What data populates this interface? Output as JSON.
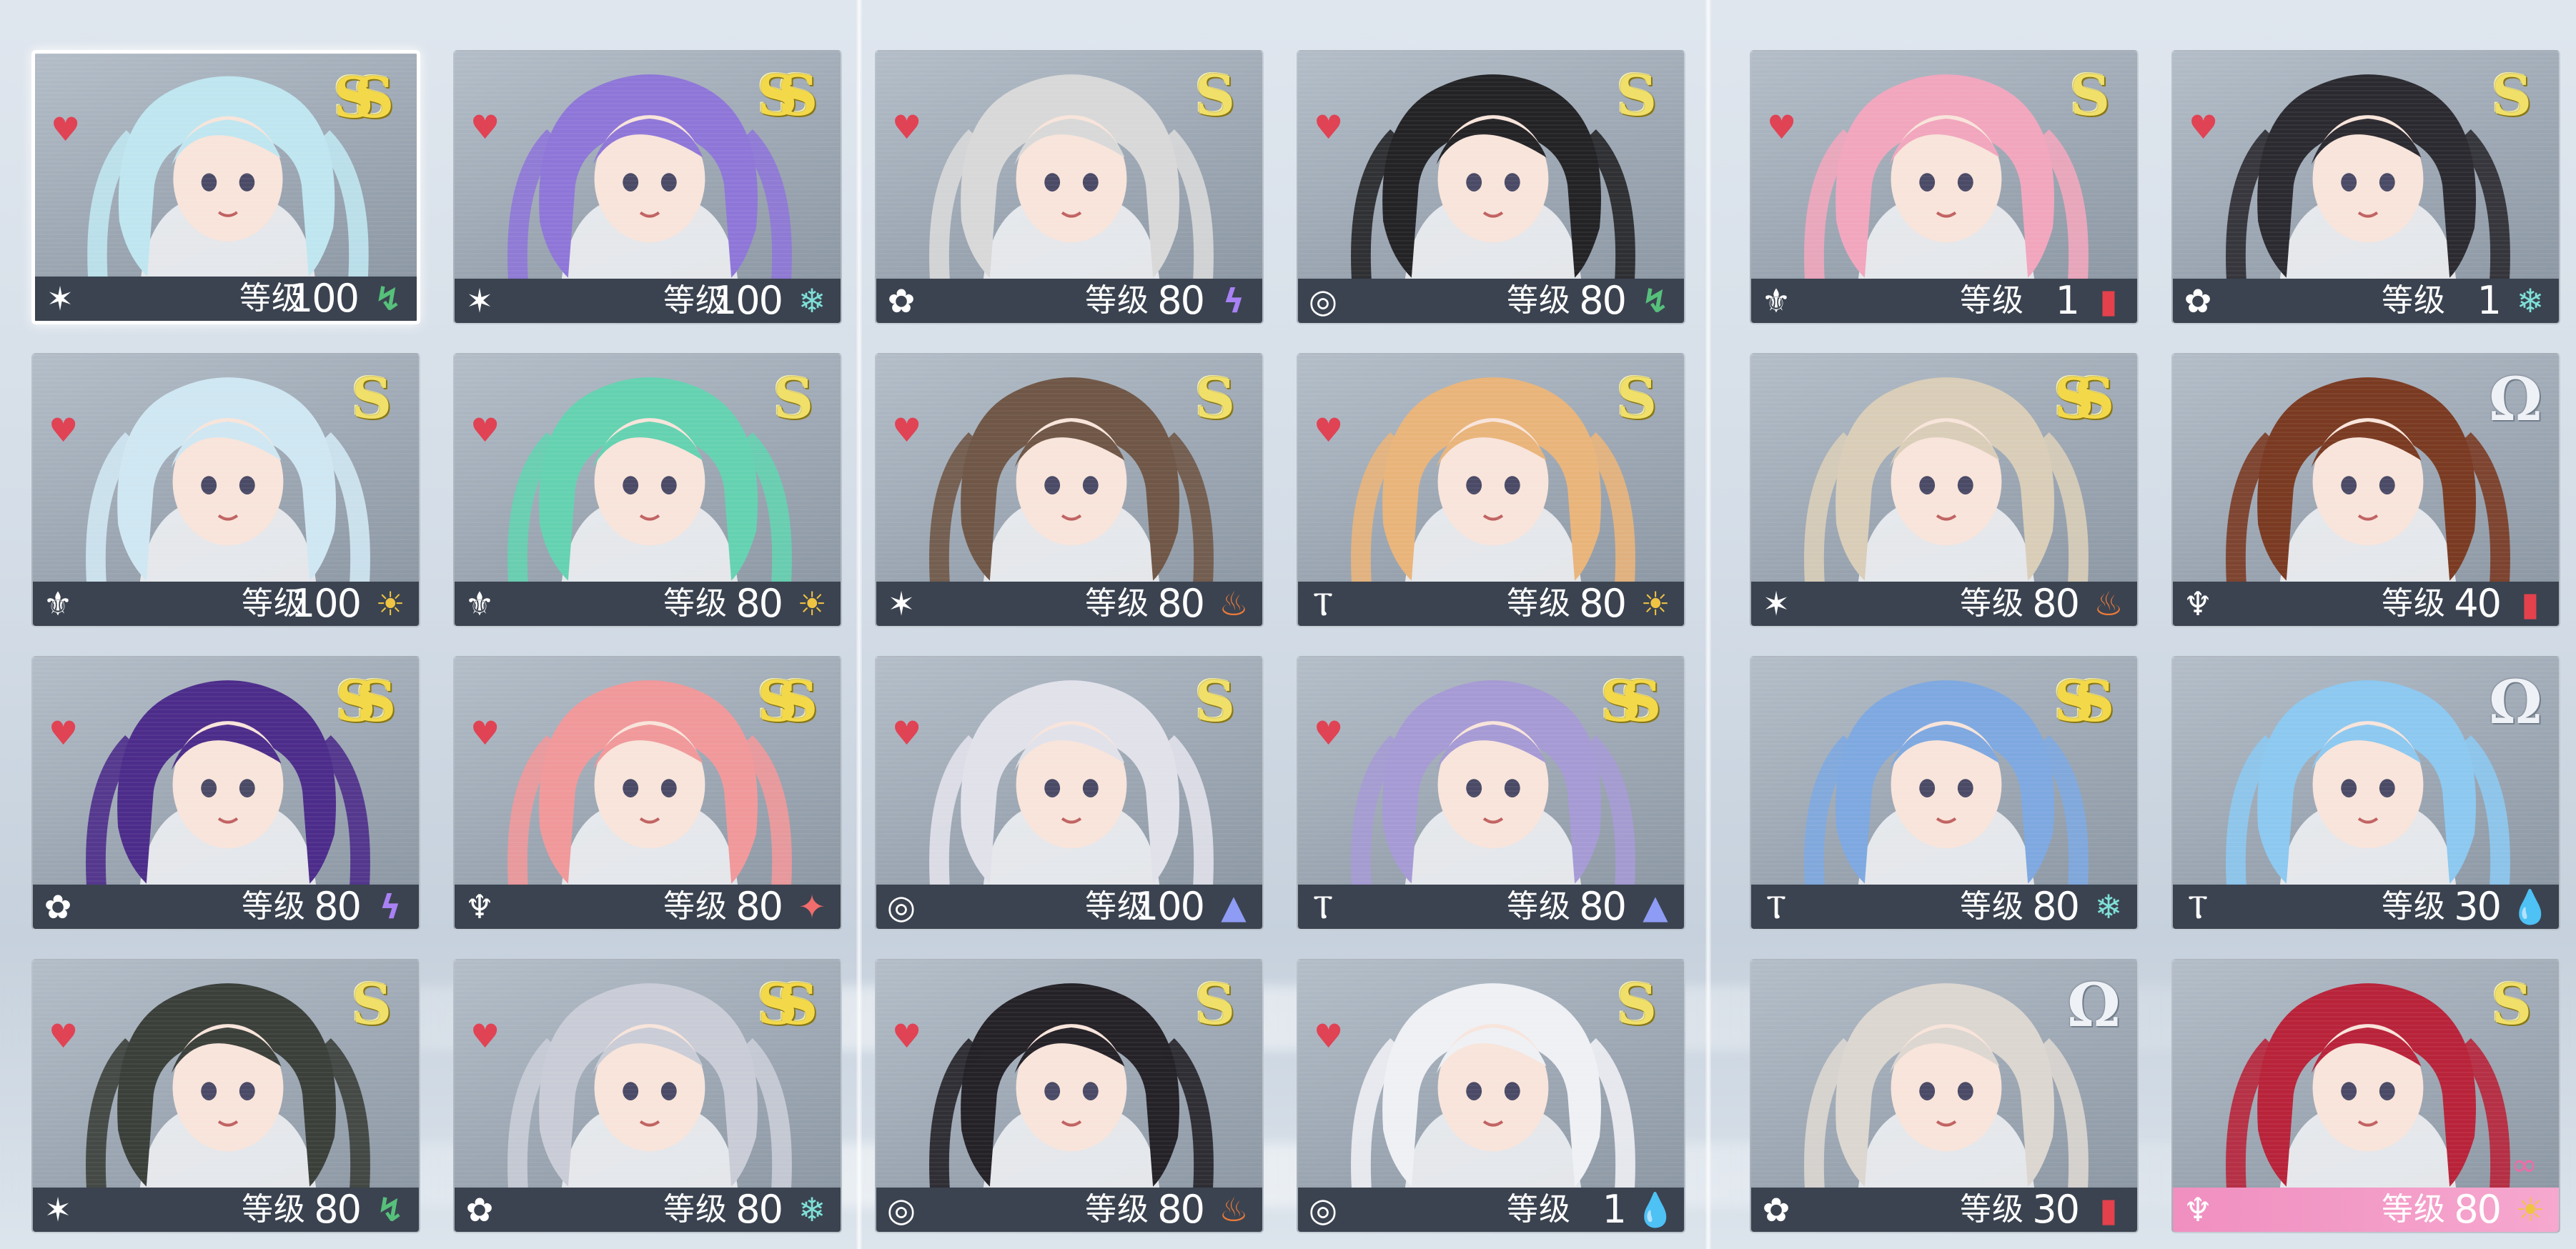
{
  "level_label": "等级",
  "rank_glyphs": {
    "S": "S",
    "SS": "SS",
    "Omega": "Ω"
  },
  "heart_glyph": "♥",
  "team_icons": {
    "star-burst-icon": "✶",
    "flower-icon": "✿",
    "swirl-icon": "◎",
    "crest-icon": "⚜",
    "pillar-icon": "Ⲧ",
    "tree-icon": "♆"
  },
  "element_icons": {
    "wind-icon": {
      "glyph": "↯",
      "color": "#56c07b"
    },
    "ice-icon": {
      "glyph": "❄",
      "color": "#7fe0d8"
    },
    "lightning-icon": {
      "glyph": "ϟ",
      "color": "#a981f5"
    },
    "sun-icon": {
      "glyph": "☀",
      "color": "#f0c443"
    },
    "fire-icon": {
      "glyph": "♨",
      "color": "#ec7b3a"
    },
    "void-icon": {
      "glyph": "▲",
      "color": "#8f9cf5"
    },
    "physical-icon": {
      "glyph": "✦",
      "color": "#f16c6c"
    },
    "water-icon": {
      "glyph": "💧",
      "color": "#5fa7ea"
    },
    "quantum-icon": {
      "glyph": "▮",
      "color": "#e4414c"
    }
  },
  "cards": [
    {
      "rank": "SS",
      "level": "100",
      "team": "star-burst-icon",
      "element": "wind-icon",
      "heart": true,
      "selected": true,
      "hair": "#bfe6f0"
    },
    {
      "rank": "SS",
      "level": "100",
      "team": "star-burst-icon",
      "element": "ice-icon",
      "heart": true,
      "hair": "#8e76d8"
    },
    {
      "rank": "S",
      "level": "80",
      "team": "flower-icon",
      "element": "lightning-icon",
      "heart": true,
      "hair": "#d8d8d8"
    },
    {
      "rank": "S",
      "level": "80",
      "team": "swirl-icon",
      "element": "wind-icon",
      "heart": true,
      "hair": "#232326"
    },
    {
      "rank": "S",
      "level": "1",
      "team": "crest-icon",
      "element": "quantum-icon",
      "heart": true,
      "hair": "#f1a6bd"
    },
    {
      "rank": "S",
      "level": "1",
      "team": "flower-icon",
      "element": "ice-icon",
      "heart": true,
      "hair": "#2b2a30"
    },
    {
      "rank": "S",
      "level": "100",
      "team": "crest-icon",
      "element": "sun-icon",
      "heart": true,
      "hair": "#cfe7f2"
    },
    {
      "rank": "S",
      "level": "80",
      "team": "crest-icon",
      "element": "sun-icon",
      "heart": true,
      "hair": "#64d2b0"
    },
    {
      "rank": "S",
      "level": "80",
      "team": "star-burst-icon",
      "element": "fire-icon",
      "heart": true,
      "hair": "#6f5646"
    },
    {
      "rank": "S",
      "level": "80",
      "team": "pillar-icon",
      "element": "sun-icon",
      "heart": true,
      "hair": "#e9b47a"
    },
    {
      "rank": "SS",
      "level": "80",
      "team": "star-burst-icon",
      "element": "fire-icon",
      "heart": false,
      "hair": "#d9cdb8"
    },
    {
      "rank": "Omega",
      "level": "40",
      "team": "tree-icon",
      "element": "quantum-icon",
      "heart": false,
      "hair": "#7a3a22"
    },
    {
      "rank": "SS",
      "level": "80",
      "team": "flower-icon",
      "element": "lightning-icon",
      "heart": true,
      "hair": "#4c2c8a"
    },
    {
      "rank": "SS",
      "level": "80",
      "team": "tree-icon",
      "element": "physical-icon",
      "heart": true,
      "hair": "#f0989a"
    },
    {
      "rank": "S",
      "level": "100",
      "team": "swirl-icon",
      "element": "void-icon",
      "heart": true,
      "hair": "#e1e1ea"
    },
    {
      "rank": "SS",
      "level": "80",
      "team": "pillar-icon",
      "element": "void-icon",
      "heart": true,
      "hair": "#a59ad4"
    },
    {
      "rank": "SS",
      "level": "80",
      "team": "pillar-icon",
      "element": "ice-icon",
      "heart": false,
      "hair": "#7ea8e0"
    },
    {
      "rank": "Omega",
      "level": "30",
      "team": "pillar-icon",
      "element": "water-icon",
      "heart": false,
      "hair": "#8cc8f0"
    },
    {
      "rank": "S",
      "level": "80",
      "team": "star-burst-icon",
      "element": "wind-icon",
      "heart": true,
      "hair": "#3b3f3a"
    },
    {
      "rank": "SS",
      "level": "80",
      "team": "flower-icon",
      "element": "ice-icon",
      "heart": true,
      "hair": "#c9ccd6"
    },
    {
      "rank": "S",
      "level": "80",
      "team": "swirl-icon",
      "element": "fire-icon",
      "heart": true,
      "hair": "#242127"
    },
    {
      "rank": "S",
      "level": "1",
      "team": "swirl-icon",
      "element": "water-icon",
      "heart": true,
      "hair": "#eef0f4"
    },
    {
      "rank": "Omega",
      "level": "30",
      "team": "flower-icon",
      "element": "quantum-icon",
      "heart": false,
      "hair": "#dcd6d0"
    },
    {
      "rank": "S",
      "level": "80",
      "team": "tree-icon",
      "element": "sun-icon",
      "heart": false,
      "hair": "#b8233a",
      "pink_bar": true,
      "badge": "∞"
    }
  ]
}
